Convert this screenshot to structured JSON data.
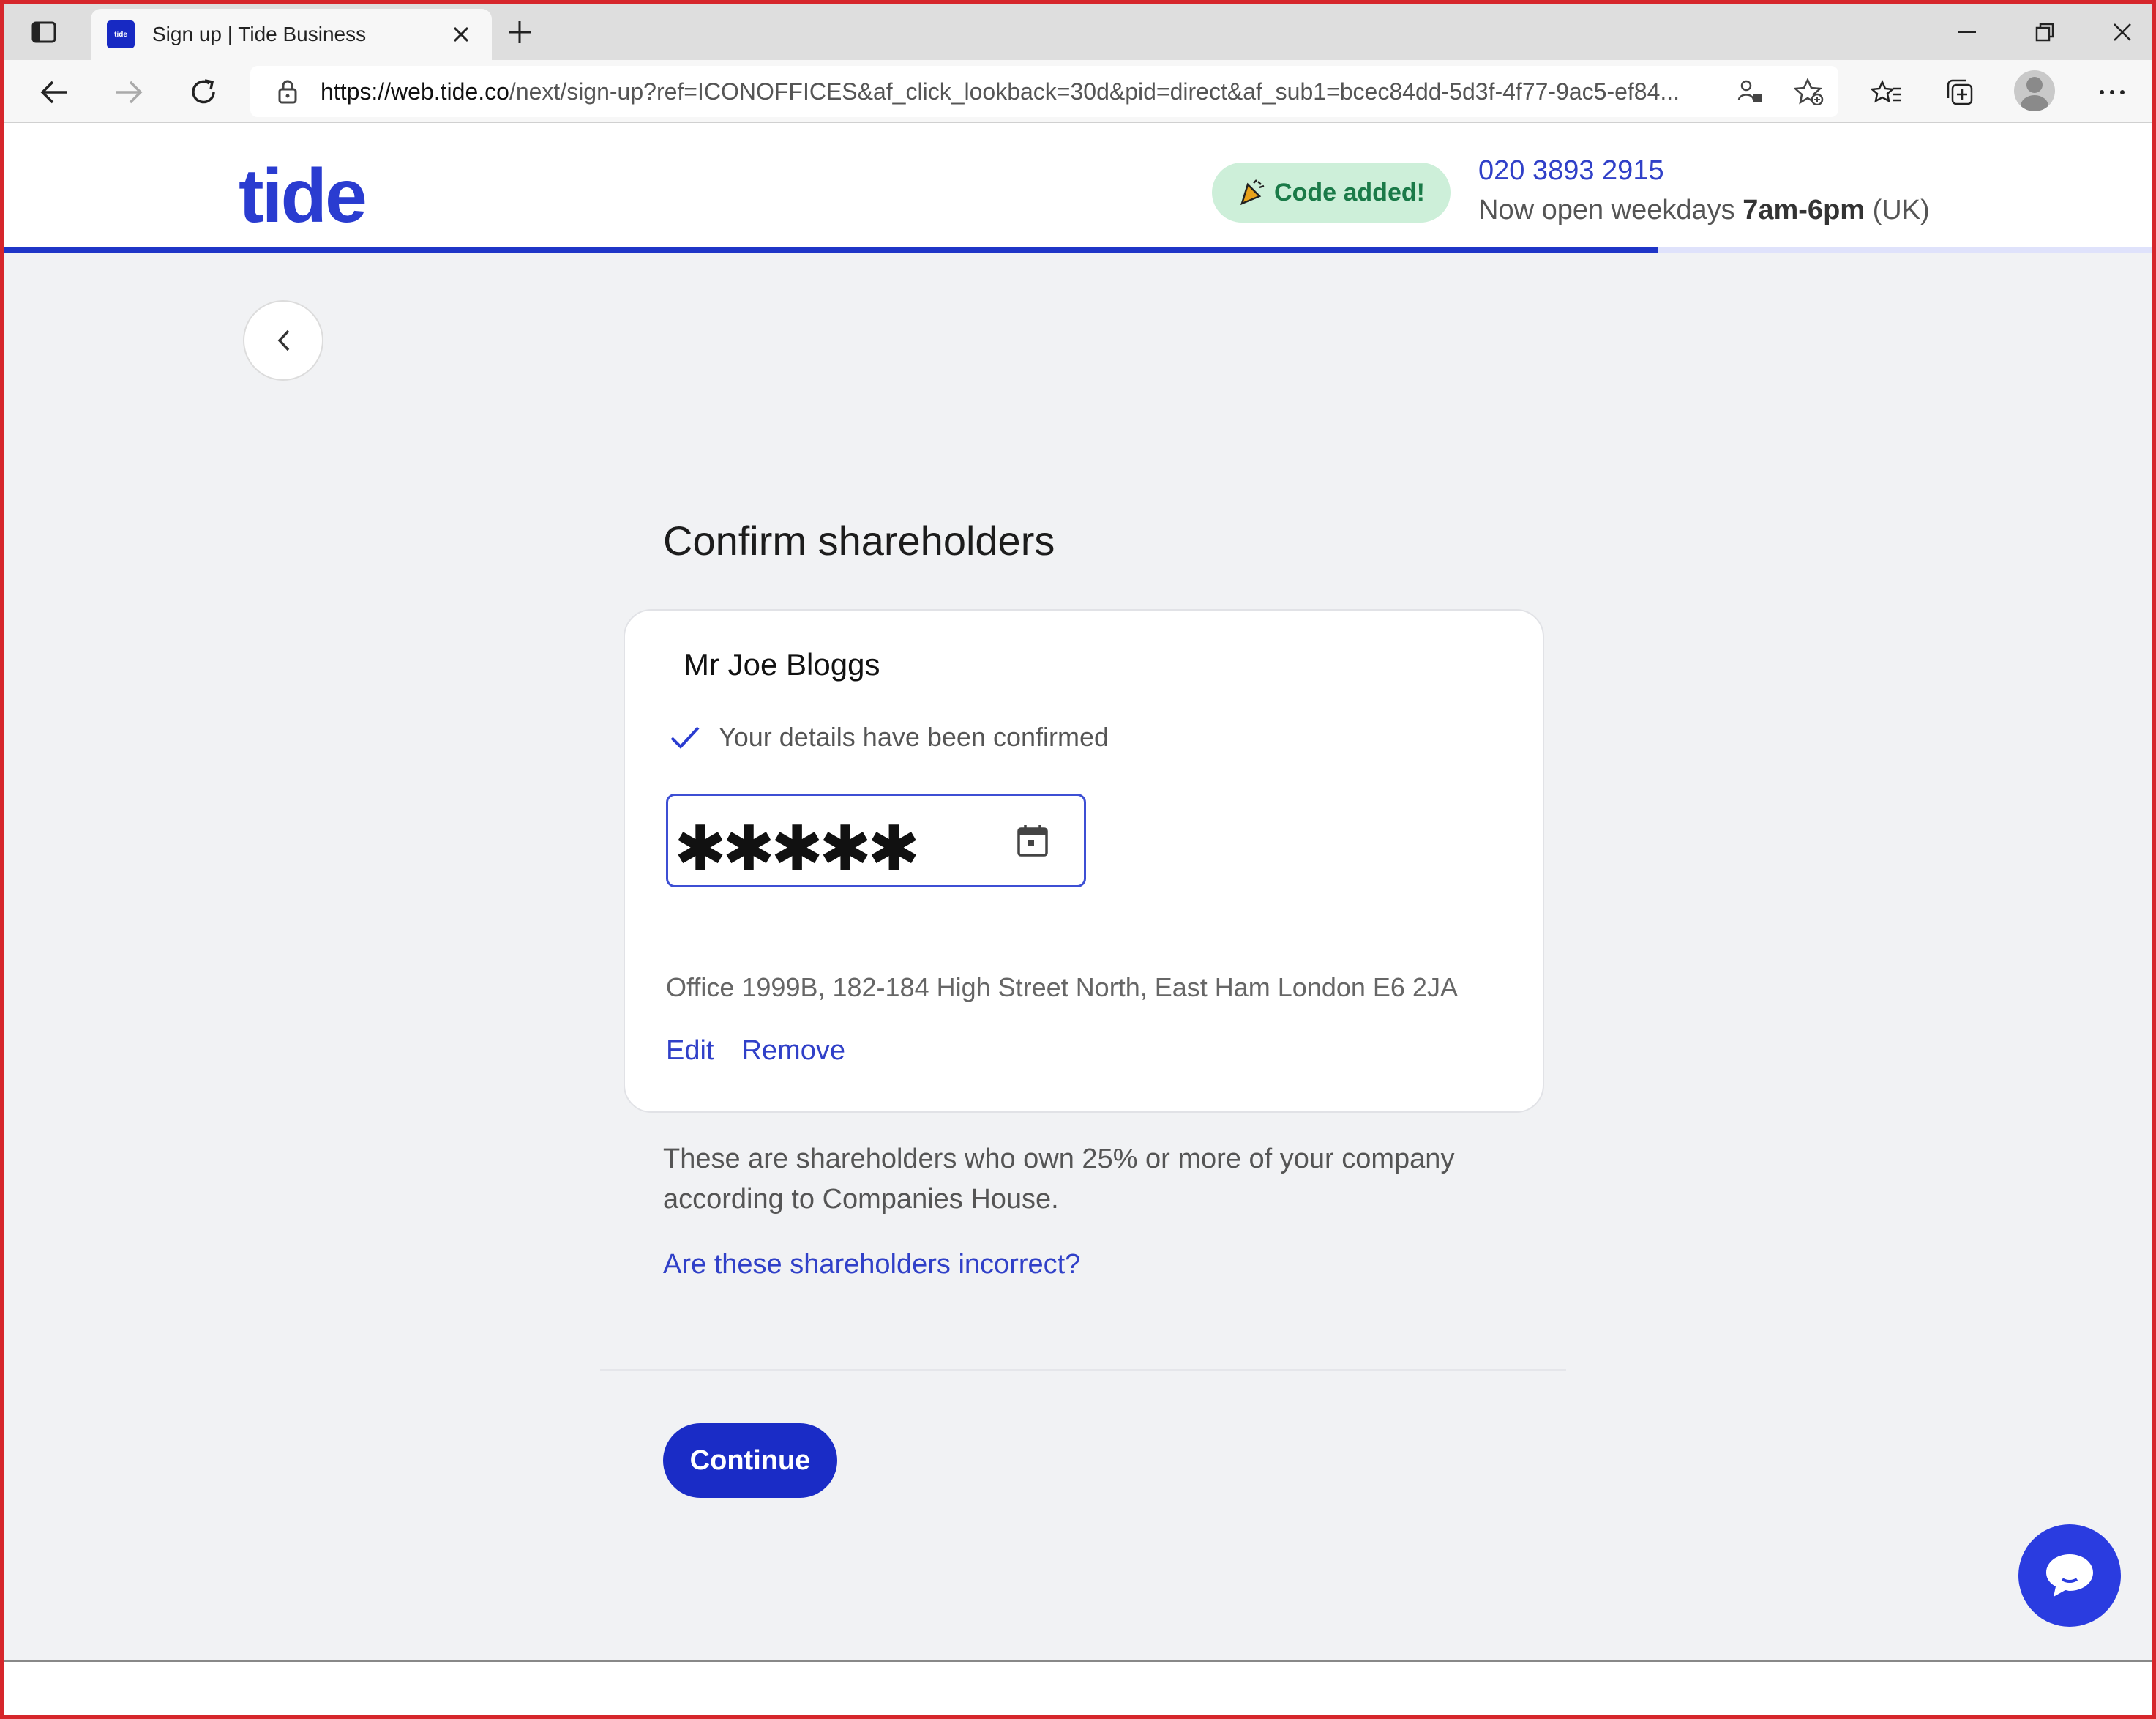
{
  "browser": {
    "tab_title": "Sign up | Tide Business",
    "favicon_text": "tide",
    "url_domain": "https://web.tide.co",
    "url_path": "/next/sign-up?ref=ICONOFFICES&af_click_lookback=30d&pid=direct&af_sub1=bcec84dd-5d3f-4f77-9ac5-ef84..."
  },
  "header": {
    "logo": "tide",
    "code_badge": "Code added!",
    "phone": "020 3893 2915",
    "hours_prefix": "Now open weekdays ",
    "hours_bold": "7am-6pm",
    "hours_suffix": " (UK)",
    "progress_fraction": 0.77
  },
  "main": {
    "title": "Confirm shareholders",
    "shareholder": {
      "name": "Mr Joe Bloggs",
      "status": "Your details have been confirmed",
      "date_value": "✱✱✱✱✱",
      "address": "Office 1999B, 182-184 High Street North, East Ham London E6 2JA",
      "edit_label": "Edit",
      "remove_label": "Remove"
    },
    "info": "These are shareholders who own 25% or more of your company according to Companies House.",
    "incorrect_link": "Are these shareholders incorrect?",
    "continue_label": "Continue"
  },
  "colors": {
    "brand": "#1a2cc6",
    "link": "#3040c8",
    "success_bg": "#cdefd9",
    "success_text": "#1a7a48",
    "page_bg": "#f1f2f4"
  }
}
